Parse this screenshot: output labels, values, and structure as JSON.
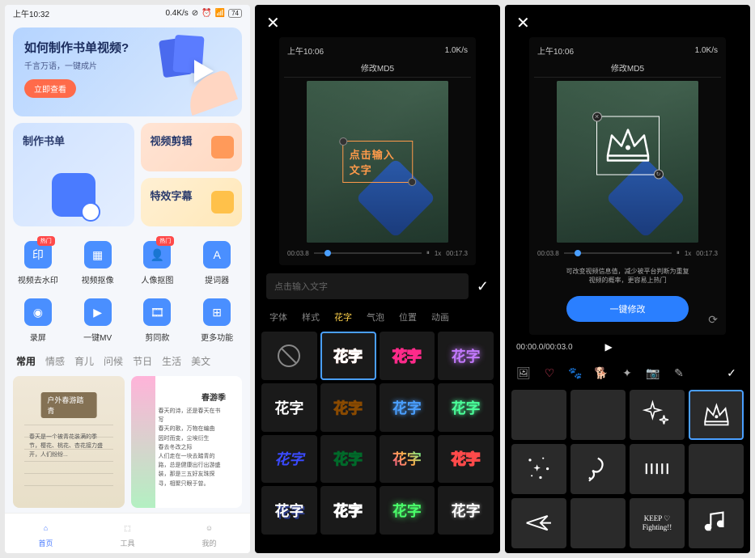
{
  "phone1": {
    "status": {
      "time": "上午10:32",
      "net": "0.4K/s",
      "battery": "74"
    },
    "banner": {
      "title": "如何制作书单视频?",
      "subtitle": "千言万语，一键成片",
      "button": "立即查看"
    },
    "main_cards": {
      "left": "制作书单",
      "right1": "视频剪辑",
      "right2": "特效字幕"
    },
    "grid": [
      {
        "label": "视频去水印",
        "hot": "热门"
      },
      {
        "label": "视频抠像",
        "hot": ""
      },
      {
        "label": "人像抠图",
        "hot": "热门"
      },
      {
        "label": "提词器",
        "hot": ""
      },
      {
        "label": "录屏",
        "hot": ""
      },
      {
        "label": "一键MV",
        "hot": ""
      },
      {
        "label": "剪同款",
        "hot": ""
      },
      {
        "label": "更多功能",
        "hot": ""
      }
    ],
    "tabs": [
      "常用",
      "情感",
      "育儿",
      "问候",
      "节日",
      "生活",
      "美文"
    ],
    "content": {
      "card1_tag": "户外春游踏青",
      "card1_text": "春天是一个被青花装满的季节，樱花、桃花、杏花接力盛开，人们纷纷...",
      "card2_title": "春游季",
      "card2_text": "春天的诗，还是春天在书写\n春天的歌，万物在编曲\n因时而变，尘埃衍生\n春去冬改之际\n人们走在一块去踏青的路，总是健康出行出游盛装，那是三五好友珠探寻，相聚只眼于曾。"
    },
    "bottom_nav": [
      "首页",
      "工具",
      "我的"
    ]
  },
  "phone2": {
    "status": {
      "time": "上午10:06",
      "net": "1.0K/s"
    },
    "preview_title": "修改MD5",
    "overlay_text": "点击输入文字",
    "playback": {
      "current": "00:03.8",
      "speed": "1x",
      "total": "00:17.3"
    },
    "input_placeholder": "点击输入文字",
    "tabs": [
      "字体",
      "样式",
      "花字",
      "气泡",
      "位置",
      "动画"
    ],
    "style_label": "花字"
  },
  "phone3": {
    "status": {
      "time": "上午10:06",
      "net": "1.0K/s"
    },
    "preview_title": "修改MD5",
    "tip": "可改变视频信息值，减少被平台判断为重复\n视频的概率，更容易上热门",
    "action_button": "一键修改",
    "playback": {
      "current": "00:03.8",
      "speed": "1x",
      "total": "00:17.3"
    },
    "timeline": "00:00.0/00:03.0",
    "keep_text": "KEEP ♡\nFighting!!"
  }
}
